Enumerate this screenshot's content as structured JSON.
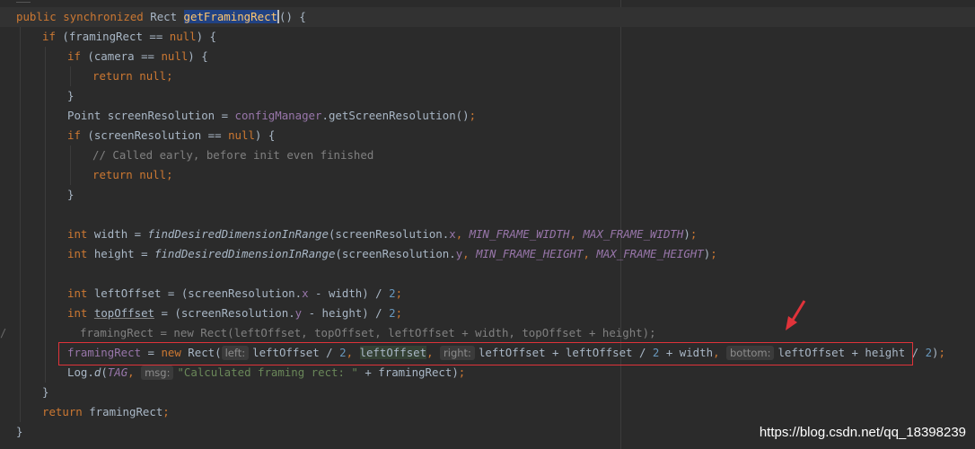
{
  "colors": {
    "background": "#2b2b2b",
    "keyword": "#cc7832",
    "method_declaration": "#ffc66d",
    "field": "#9876aa",
    "number": "#6897bb",
    "string": "#6a8759",
    "comment": "#808080",
    "selection": "#214283",
    "highlight_box": "#e0333a"
  },
  "code": {
    "l1": {
      "public": "public",
      "synchronized": "synchronized",
      "type": "Rect",
      "method": "getFramingRect",
      "rest": "() {"
    },
    "l2": {
      "if": "if",
      "pre": " (framingRect ",
      "op": "==",
      "null": "null",
      "rest": ") {"
    },
    "l3": {
      "if": "if",
      "pre": " (camera ",
      "op": "==",
      "null": "null",
      "rest": ") {"
    },
    "l4": {
      "return": "return",
      "null": "null",
      "semi": ";"
    },
    "l5": {
      "brace": "}"
    },
    "l6": {
      "pre": "Point screenResolution = ",
      "field": "configManager",
      "rest": ".getScreenResolution()",
      "semi": ";"
    },
    "l7": {
      "if": "if",
      "pre": " (screenResolution ",
      "op": "==",
      "null": "null",
      "rest": ") {"
    },
    "l8": {
      "comment": "// Called early, before init even finished"
    },
    "l9": {
      "return": "return",
      "null": "null",
      "semi": ";"
    },
    "l10": {
      "brace": "}"
    },
    "l11": {
      "int": "int",
      "pre": " width = ",
      "call": "findDesiredDimensionInRange",
      "arg1": "(screenResolution.",
      "x": "x",
      "c1": ", ",
      "c1b": ", ",
      "min": "MIN_FRAME_WIDTH",
      "max": "MAX_FRAME_WIDTH",
      "end": ")",
      "semi": ";"
    },
    "l12": {
      "int": "int",
      "pre": " height = ",
      "call": "findDesiredDimensionInRange",
      "arg1": "(screenResolution.",
      "y": "y",
      "c1": ", ",
      "c1b": ", ",
      "min": "MIN_FRAME_HEIGHT",
      "max": "MAX_FRAME_HEIGHT",
      "end": ")",
      "semi": ";"
    },
    "l13": {
      "int": "int",
      "pre": " leftOffset = (screenResolution.",
      "x": "x",
      "rest": " - width) / ",
      "num": "2",
      "semi": ";"
    },
    "l14": {
      "int": "int",
      "sp": " ",
      "var": "topOffset",
      "pre": " = (screenResolution.",
      "y": "y",
      "rest": " - height) / ",
      "num": "2",
      "semi": ";"
    },
    "l15": {
      "comment": "framingRect = new Rect(leftOffset, topOffset, leftOffset + width, topOffset + height);"
    },
    "l16": {
      "var": "framingRect",
      "eq": " = ",
      "new": "new",
      "rect": " Rect(",
      "hint_left": "left:",
      "a1": "leftOffset / ",
      "n1": "2",
      "c1": ", ",
      "a2": "leftOffset",
      "c2": ", ",
      "hint_right": "right:",
      "a3": "leftOffset + leftOffset / ",
      "n3": "2",
      "a3b": " + width",
      "c3": ", ",
      "hint_bottom": "bottom:",
      "a4": "leftOffset + height / ",
      "n4": "2",
      "end": ")",
      "semi": ";"
    },
    "l17": {
      "pre": "Log.",
      "d": "d",
      "open": "(",
      "tag": "TAG",
      "c1": ", ",
      "hint_msg": "msg:",
      "str": "\"Calculated framing rect: \"",
      "rest": " + framingRect)",
      "semi": ";"
    },
    "l18": {
      "brace": "}"
    },
    "l19": {
      "return": "return",
      "rest": " framingRect",
      "semi": ";"
    },
    "l20": {
      "brace": "}"
    }
  },
  "gutter_marker": "/",
  "watermark": "https://blog.csdn.net/qq_18398239"
}
